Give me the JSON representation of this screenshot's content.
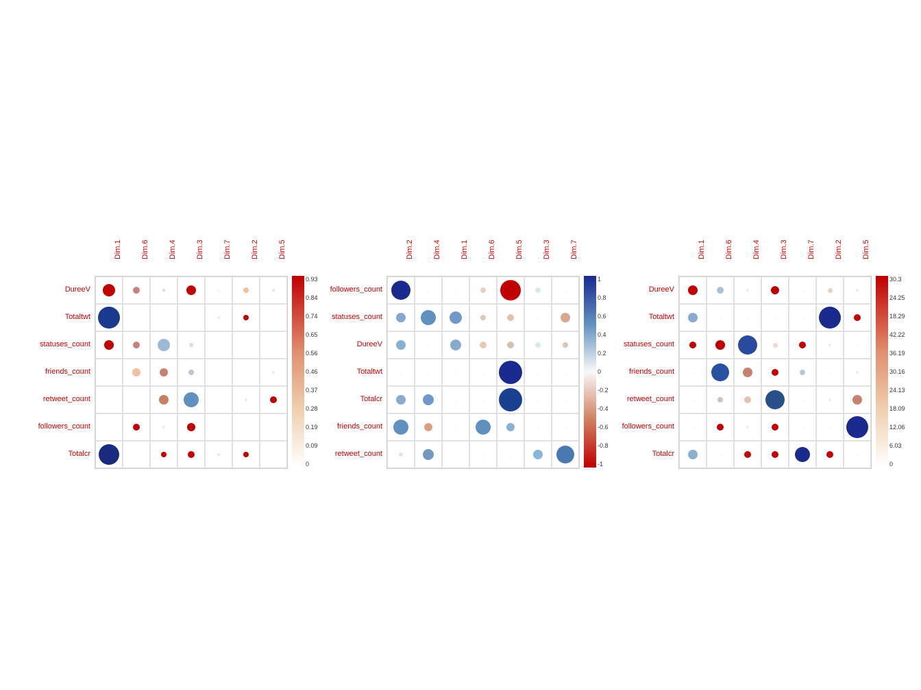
{
  "charts": [
    {
      "id": "chart1",
      "colHeaders": [
        "Dim.1",
        "Dim.6",
        "Dim.4",
        "Dim.3",
        "Dim.7",
        "Dim.2",
        "Dim.5"
      ],
      "rowLabels": [
        "DureeV",
        "Totaltwt",
        "statuses_count",
        "friends_count",
        "retweet_count",
        "followers_count",
        "Totalcr"
      ],
      "legendType": "magnitude",
      "legendValues": [
        "0.93",
        "0.84",
        "0.74",
        "0.65",
        "0.56",
        "0.46",
        "0.37",
        "0.28",
        "0.19",
        "0.09",
        "0"
      ],
      "cells": [
        [
          {
            "color": "#c00000",
            "size": 18
          },
          {
            "color": "#c88080",
            "size": 10
          },
          {
            "color": "#f0d0d0",
            "size": 4
          },
          {
            "color": "#c00000",
            "size": 14
          },
          {
            "color": "#f8e8e8",
            "size": 3
          },
          {
            "color": "#f0c0a0",
            "size": 8
          },
          {
            "color": "#e8e0e8",
            "size": 4
          }
        ],
        [
          {
            "color": "#1a3a8f",
            "size": 32
          },
          {
            "color": "#f8f8f8",
            "size": 3
          },
          {
            "color": "#f8f8f8",
            "size": 3
          },
          {
            "color": "#f8f8f8",
            "size": 3
          },
          {
            "color": "#e8e8f0",
            "size": 4
          },
          {
            "color": "#c00000",
            "size": 8
          },
          {
            "color": "#f8f8f8",
            "size": 3
          }
        ],
        [
          {
            "color": "#c00000",
            "size": 14
          },
          {
            "color": "#c88080",
            "size": 10
          },
          {
            "color": "#a0b8d8",
            "size": 18
          },
          {
            "color": "#f0d0d0",
            "size": 6
          },
          {
            "color": "#f8f8f8",
            "size": 3
          },
          {
            "color": "#f8f8f8",
            "size": 3
          },
          {
            "color": "#f8f8f8",
            "size": 3
          }
        ],
        [
          {
            "color": "#f8f8f8",
            "size": 3
          },
          {
            "color": "#f0c0a0",
            "size": 12
          },
          {
            "color": "#c88070",
            "size": 12
          },
          {
            "color": "#c0c0d8",
            "size": 8
          },
          {
            "color": "#f8f8f8",
            "size": 3
          },
          {
            "color": "#f8f8f8",
            "size": 3
          },
          {
            "color": "#f8e8e8",
            "size": 4
          }
        ],
        [
          {
            "color": "#f8f8f8",
            "size": 3
          },
          {
            "color": "#f8f8f8",
            "size": 3
          },
          {
            "color": "#c88060",
            "size": 14
          },
          {
            "color": "#6090c0",
            "size": 22
          },
          {
            "color": "#f8f8f8",
            "size": 3
          },
          {
            "color": "#f8e8e8",
            "size": 4
          },
          {
            "color": "#c00000",
            "size": 10
          }
        ],
        [
          {
            "color": "#f8f8f8",
            "size": 3
          },
          {
            "color": "#c00000",
            "size": 10
          },
          {
            "color": "#f8e8e8",
            "size": 4
          },
          {
            "color": "#c00000",
            "size": 12
          },
          {
            "color": "#f8f8f8",
            "size": 3
          },
          {
            "color": "#f8f8f8",
            "size": 3
          },
          {
            "color": "#f8f8f8",
            "size": 3
          }
        ],
        [
          {
            "color": "#1a2a7f",
            "size": 30
          },
          {
            "color": "#f8f8f8",
            "size": 3
          },
          {
            "color": "#c00000",
            "size": 8
          },
          {
            "color": "#c00000",
            "size": 10
          },
          {
            "color": "#e8e8e8",
            "size": 4
          },
          {
            "color": "#c00000",
            "size": 8
          },
          {
            "color": "#f8f8f8",
            "size": 3
          }
        ]
      ]
    },
    {
      "id": "chart2",
      "colHeaders": [
        "Dim.2",
        "Dim.4",
        "Dim.1",
        "Dim.6",
        "Dim.5",
        "Dim.3",
        "Dim.7"
      ],
      "rowLabels": [
        "followers_count",
        "statuses_count",
        "DureeV",
        "Totaltwt",
        "Totalcr",
        "friends_count",
        "retweet_count"
      ],
      "legendType": "correlation",
      "legendValues": [
        "1",
        "0.8",
        "0.6",
        "0.4",
        "0.2",
        "0",
        "-0.2",
        "-0.4",
        "-0.6",
        "-0.8",
        "-1"
      ],
      "cells": [
        [
          {
            "color": "#1a2a8f",
            "size": 28
          },
          {
            "color": "#f8f8f8",
            "size": 3
          },
          {
            "color": "#f8f8f8",
            "size": 3
          },
          {
            "color": "#e8d0c0",
            "size": 8
          },
          {
            "color": "#c00000",
            "size": 30
          },
          {
            "color": "#d8e8f0",
            "size": 8
          },
          {
            "color": "#f8f8f8",
            "size": 3
          }
        ],
        [
          {
            "color": "#88a8d0",
            "size": 14
          },
          {
            "color": "#6090c0",
            "size": 22
          },
          {
            "color": "#7098c8",
            "size": 18
          },
          {
            "color": "#e0c8b8",
            "size": 8
          },
          {
            "color": "#e0c0b0",
            "size": 10
          },
          {
            "color": "#f8f8f8",
            "size": 3
          },
          {
            "color": "#d8a890",
            "size": 14
          }
        ],
        [
          {
            "color": "#88b0d0",
            "size": 14
          },
          {
            "color": "#f8f8f8",
            "size": 3
          },
          {
            "color": "#88aacc",
            "size": 16
          },
          {
            "color": "#e8c8b0",
            "size": 10
          },
          {
            "color": "#d8c0b0",
            "size": 10
          },
          {
            "color": "#d8e8f0",
            "size": 8
          },
          {
            "color": "#e0c0b0",
            "size": 8
          }
        ],
        [
          {
            "color": "#f8f8f8",
            "size": 3
          },
          {
            "color": "#f8f8f8",
            "size": 3
          },
          {
            "color": "#f8f8f8",
            "size": 3
          },
          {
            "color": "#f8f8f8",
            "size": 3
          },
          {
            "color": "#1a2a8f",
            "size": 34
          },
          {
            "color": "#f8f8f8",
            "size": 3
          },
          {
            "color": "#f8f8f8",
            "size": 3
          }
        ],
        [
          {
            "color": "#8aaad0",
            "size": 14
          },
          {
            "color": "#7098c8",
            "size": 16
          },
          {
            "color": "#f8f8f8",
            "size": 3
          },
          {
            "color": "#f8f8f8",
            "size": 3
          },
          {
            "color": "#1a4090",
            "size": 34
          },
          {
            "color": "#f8f8f8",
            "size": 3
          },
          {
            "color": "#f8f8f8",
            "size": 3
          }
        ],
        [
          {
            "color": "#6090c0",
            "size": 22
          },
          {
            "color": "#d8a080",
            "size": 12
          },
          {
            "color": "#f8f8f8",
            "size": 3
          },
          {
            "color": "#6090c0",
            "size": 22
          },
          {
            "color": "#88b0d0",
            "size": 12
          },
          {
            "color": "#f8f8f8",
            "size": 3
          },
          {
            "color": "#f8f8f8",
            "size": 3
          }
        ],
        [
          {
            "color": "#f0e0d8",
            "size": 6
          },
          {
            "color": "#7098c0",
            "size": 16
          },
          {
            "color": "#f8f8f8",
            "size": 3
          },
          {
            "color": "#f8f8f8",
            "size": 3
          },
          {
            "color": "#f8f8f8",
            "size": 3
          },
          {
            "color": "#88b8d8",
            "size": 14
          },
          {
            "color": "#4a78b0",
            "size": 26
          }
        ]
      ]
    },
    {
      "id": "chart3",
      "colHeaders": [
        "Dim.1",
        "Dim.6",
        "Dim.4",
        "Dim.3",
        "Dim.7",
        "Dim.2",
        "Dim.5"
      ],
      "rowLabels": [
        "DureeV",
        "Totaltwt",
        "statuses_count",
        "friends_count",
        "retweet_count",
        "followers_count",
        "Totalcr"
      ],
      "legendType": "magnitude2",
      "legendValues": [
        "30.3",
        "24.25",
        "18.29",
        "42.22",
        "36.19",
        "30.16",
        "24.13",
        "18.09",
        "12.06",
        "6.03",
        "0"
      ],
      "cells": [
        [
          {
            "color": "#c00000",
            "size": 14
          },
          {
            "color": "#a8c0d8",
            "size": 10
          },
          {
            "color": "#f0e8e8",
            "size": 4
          },
          {
            "color": "#c00000",
            "size": 12
          },
          {
            "color": "#f8f8f8",
            "size": 3
          },
          {
            "color": "#e8d0c8",
            "size": 7
          },
          {
            "color": "#f0e8e8",
            "size": 4
          }
        ],
        [
          {
            "color": "#88aad0",
            "size": 14
          },
          {
            "color": "#f8f8f8",
            "size": 3
          },
          {
            "color": "#f8f8f8",
            "size": 3
          },
          {
            "color": "#f8f8f8",
            "size": 3
          },
          {
            "color": "#f8f8f8",
            "size": 3
          },
          {
            "color": "#1a2a8f",
            "size": 32
          },
          {
            "color": "#c00000",
            "size": 10
          }
        ],
        [
          {
            "color": "#c00000",
            "size": 10
          },
          {
            "color": "#c00000",
            "size": 14
          },
          {
            "color": "#2a4a9f",
            "size": 28
          },
          {
            "color": "#f0d8d0",
            "size": 7
          },
          {
            "color": "#c00000",
            "size": 10
          },
          {
            "color": "#f0e8e8",
            "size": 4
          },
          {
            "color": "#f8f8f8",
            "size": 3
          }
        ],
        [
          {
            "color": "#f8f8f8",
            "size": 3
          },
          {
            "color": "#2a50a0",
            "size": 26
          },
          {
            "color": "#c88070",
            "size": 14
          },
          {
            "color": "#c00000",
            "size": 10
          },
          {
            "color": "#b8c8d8",
            "size": 8
          },
          {
            "color": "#f8f8f8",
            "size": 3
          },
          {
            "color": "#f8e8e8",
            "size": 4
          }
        ],
        [
          {
            "color": "#f8f8f8",
            "size": 3
          },
          {
            "color": "#d0c0b8",
            "size": 8
          },
          {
            "color": "#e8c0b0",
            "size": 10
          },
          {
            "color": "#2a508a",
            "size": 28
          },
          {
            "color": "#f8f8f8",
            "size": 3
          },
          {
            "color": "#f8e8e8",
            "size": 4
          },
          {
            "color": "#c88070",
            "size": 14
          }
        ],
        [
          {
            "color": "#f8f8f8",
            "size": 3
          },
          {
            "color": "#c00000",
            "size": 10
          },
          {
            "color": "#f8e8e8",
            "size": 4
          },
          {
            "color": "#c00000",
            "size": 10
          },
          {
            "color": "#f8f8f8",
            "size": 3
          },
          {
            "color": "#f8f8f8",
            "size": 3
          },
          {
            "color": "#1a2a8f",
            "size": 32
          }
        ],
        [
          {
            "color": "#88b0d0",
            "size": 14
          },
          {
            "color": "#f8f8f8",
            "size": 3
          },
          {
            "color": "#c00000",
            "size": 10
          },
          {
            "color": "#c00000",
            "size": 10
          },
          {
            "color": "#1a2a8f",
            "size": 22
          },
          {
            "color": "#c00000",
            "size": 10
          },
          {
            "color": "#f8f8f8",
            "size": 3
          }
        ]
      ]
    }
  ]
}
